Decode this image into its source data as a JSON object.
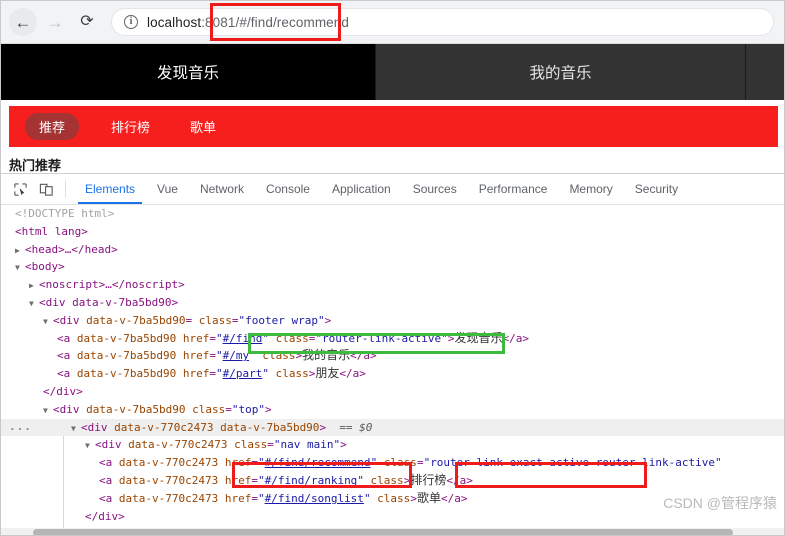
{
  "browser": {
    "back_icon": "arrow-left-icon",
    "forward_icon": "arrow-right-icon",
    "reload_icon": "reload-icon",
    "info_icon": "info-circle-icon",
    "info_glyph": "i",
    "url_host": "localhost",
    "url_port": ":8081",
    "url_path": "/#/find/recommend",
    "url_full": "localhost:8081/#/find/recommend"
  },
  "page": {
    "topnav": [
      {
        "label": "发现音乐",
        "active": true
      },
      {
        "label": "我的音乐",
        "active": false
      },
      {
        "label": "",
        "active": false
      }
    ],
    "subnav": [
      {
        "label": "推荐",
        "active": true
      },
      {
        "label": "排行榜",
        "active": false
      },
      {
        "label": "歌单",
        "active": false
      }
    ],
    "section_title": "热门推荐",
    "accent_red": "#f71e1e",
    "pill_red": "#a63333",
    "header_black": "#000000",
    "header_gray": "#333333"
  },
  "devtools": {
    "inspect_icon": "inspect-element-icon",
    "device_icon": "device-toolbar-icon",
    "tabs": [
      {
        "label": "Elements",
        "selected": true
      },
      {
        "label": "Vue",
        "selected": false
      },
      {
        "label": "Network",
        "selected": false
      },
      {
        "label": "Console",
        "selected": false
      },
      {
        "label": "Application",
        "selected": false
      },
      {
        "label": "Sources",
        "selected": false
      },
      {
        "label": "Performance",
        "selected": false
      },
      {
        "label": "Memory",
        "selected": false
      },
      {
        "label": "Security",
        "selected": false
      }
    ],
    "accent_blue": "#1a73e8"
  },
  "dom": {
    "doctype": "<!DOCTYPE html>",
    "html_open": "<html lang>",
    "head_collapsed": "<head>…</head>",
    "body_open": "<body>",
    "noscript_collapsed": "<noscript>…</noscript>",
    "div_root": "<div data-v-7ba5bd90>",
    "attr_data_v_7ba5bd90": "data-v-7ba5bd90",
    "attr_data_v_770c2473": "data-v-770c2473",
    "footer_wrap_class": "footer wrap",
    "top_class": "top",
    "nav_main_class": "nav main",
    "selected_marker": "== $0",
    "ellipsis": "...",
    "links": [
      {
        "href": "#/find",
        "class": "router-link-active",
        "text": "发现音乐"
      },
      {
        "href": "#/my",
        "class": "",
        "text": "我的音乐"
      },
      {
        "href": "#/part",
        "class": "",
        "text": "朋友"
      }
    ],
    "nav_links": [
      {
        "href": "#/find/recommend",
        "class": "router-link-exact-active router-link-active",
        "text": ""
      },
      {
        "href": "#/find/ranking",
        "class": "",
        "text": "排行榜"
      },
      {
        "href": "#/find/songlist",
        "class": "",
        "text": "歌单"
      }
    ],
    "close_div": "</div>"
  },
  "annotations": {
    "box_url": {
      "color": "#ef1b1b",
      "target": "url-path"
    },
    "box_href_find": {
      "color": "#3dbb3d",
      "target": "href-and-class-router-link-active"
    },
    "box_href_recommend": {
      "color": "#ef1b1b",
      "target": "href-find-recommend"
    },
    "box_exact_active": {
      "color": "#ef1b1b",
      "target": "router-link-exact-active-class"
    }
  },
  "watermark": "CSDN @管程序猿"
}
